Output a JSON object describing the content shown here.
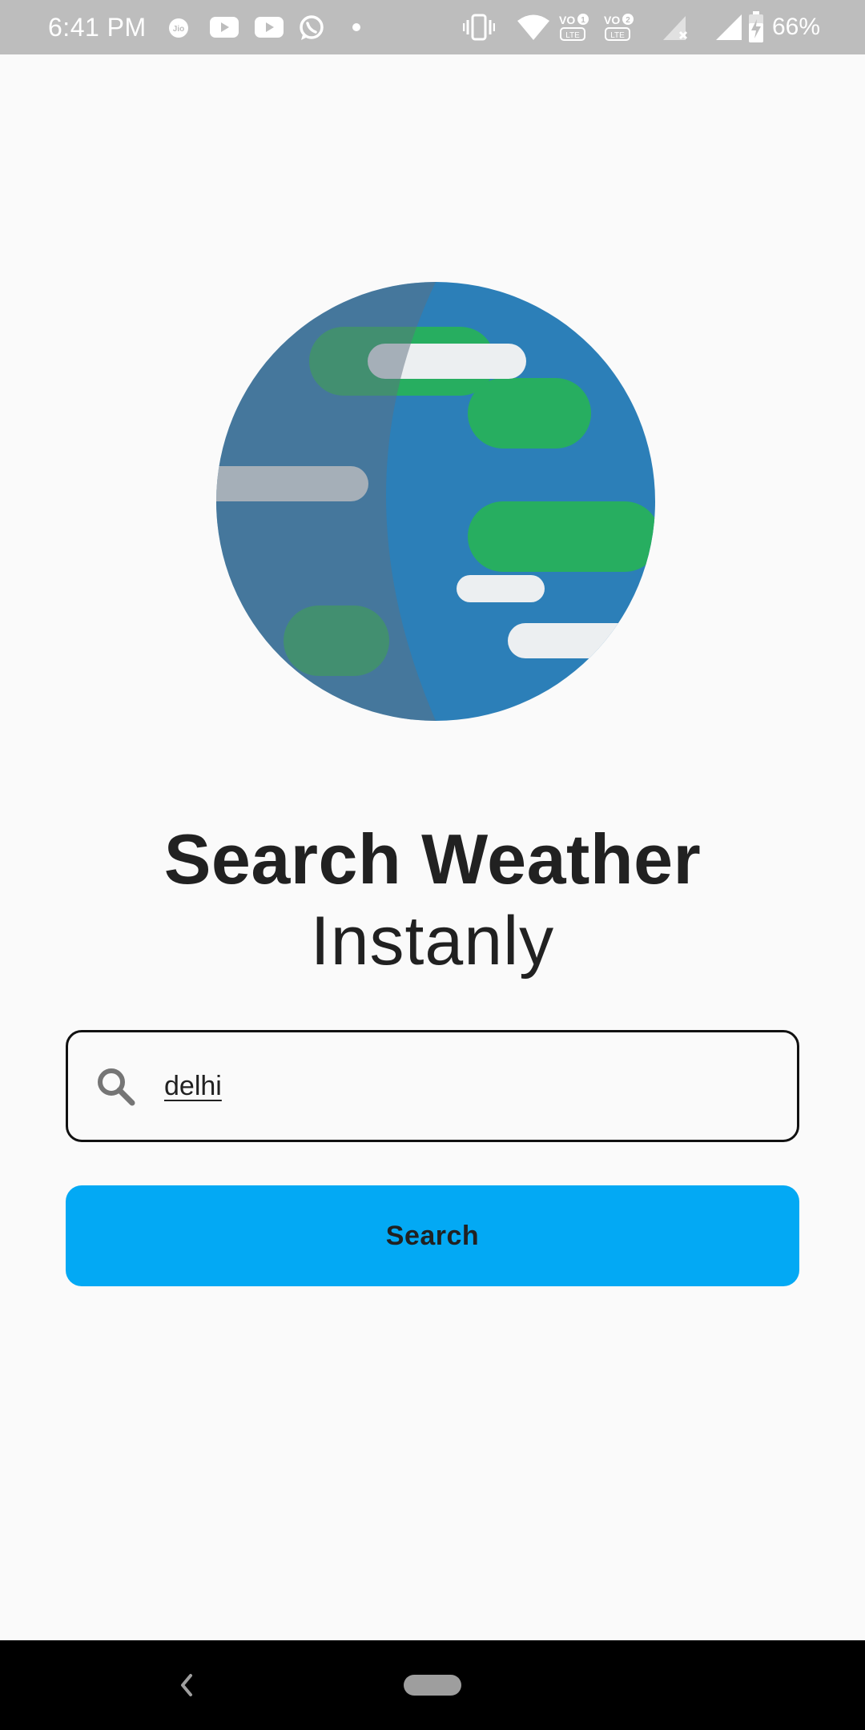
{
  "status_bar": {
    "time": "6:41 PM",
    "battery_percent": "66%",
    "notification_icons": [
      "jio-icon",
      "youtube-icon",
      "youtube-icon",
      "whatsapp-icon",
      "dot-icon"
    ],
    "system_icons": [
      "vibrate-icon",
      "wifi-icon",
      "volte1-icon",
      "volte2-icon",
      "signal-no-data-icon",
      "signal-icon",
      "battery-charging-icon"
    ],
    "background": "#bdbdbd"
  },
  "hero": {
    "title": "Search Weather",
    "subtitle": "Instanly"
  },
  "search": {
    "value": "delhi",
    "icon": "search-icon"
  },
  "search_button": {
    "label": "Search",
    "color": "#03a9f4"
  },
  "nav_bar": {
    "back_icon": "back-chevron-icon",
    "home_icon": "home-pill-icon"
  },
  "colors": {
    "globe_blue": "#2c7fb8",
    "globe_shadow": "#4a7ca1",
    "globe_green": "#27ae60",
    "globe_cloud": "#eceff1",
    "background": "#fafafa"
  }
}
